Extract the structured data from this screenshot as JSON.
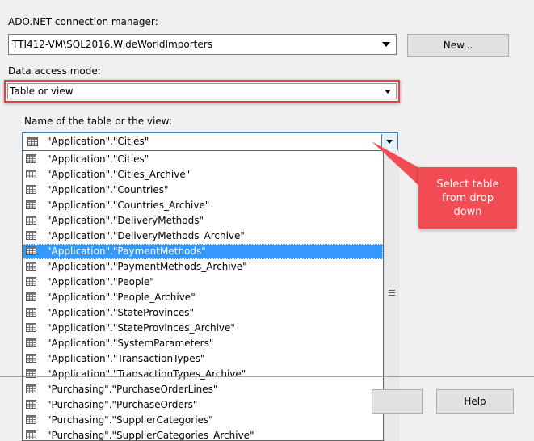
{
  "connection": {
    "label": "ADO.NET connection manager:",
    "value": "TTI412-VM\\SQL2016.WideWorldImporters",
    "new_button": "New..."
  },
  "access_mode": {
    "label": "Data access mode:",
    "value": "Table or view"
  },
  "table_select": {
    "label": "Name of the table or the view:",
    "value": "\"Application\".\"Cities\""
  },
  "list": {
    "items": [
      "\"Application\".\"Cities\"",
      "\"Application\".\"Cities_Archive\"",
      "\"Application\".\"Countries\"",
      "\"Application\".\"Countries_Archive\"",
      "\"Application\".\"DeliveryMethods\"",
      "\"Application\".\"DeliveryMethods_Archive\"",
      "\"Application\".\"PaymentMethods\"",
      "\"Application\".\"PaymentMethods_Archive\"",
      "\"Application\".\"People\"",
      "\"Application\".\"People_Archive\"",
      "\"Application\".\"StateProvinces\"",
      "\"Application\".\"StateProvinces_Archive\"",
      "\"Application\".\"SystemParameters\"",
      "\"Application\".\"TransactionTypes\"",
      "\"Application\".\"TransactionTypes_Archive\"",
      "\"Purchasing\".\"PurchaseOrderLines\"",
      "\"Purchasing\".\"PurchaseOrders\"",
      "\"Purchasing\".\"SupplierCategories\"",
      "\"Purchasing\".\"SupplierCategories_Archive\""
    ],
    "selected_index": 6
  },
  "callout": {
    "text": "Select table from drop down",
    "color": "#f14c54"
  },
  "footer": {
    "help_button": "Help"
  },
  "icons": {
    "table": "table-grid-icon",
    "dropdown": "chevron-down-icon"
  }
}
